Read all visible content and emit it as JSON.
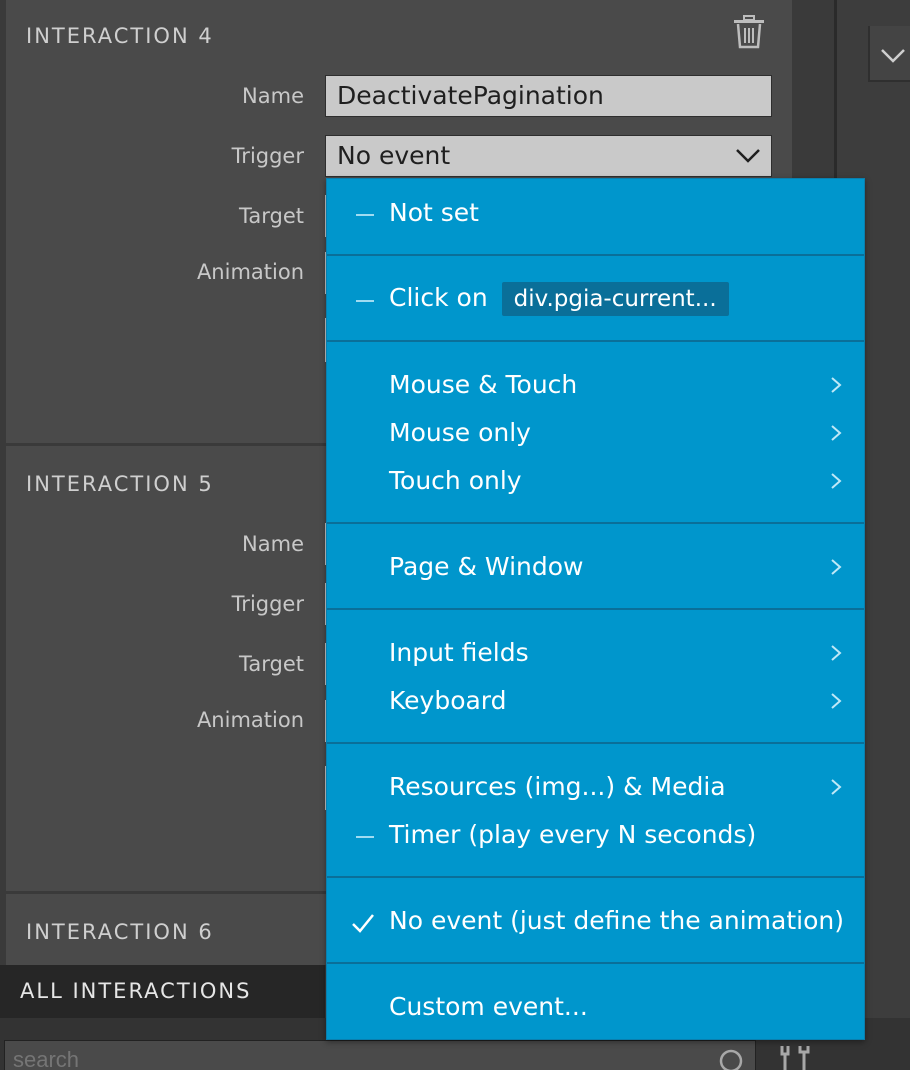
{
  "interactions": [
    {
      "title": "INTERACTION 4",
      "labels": {
        "name": "Name",
        "trigger": "Trigger",
        "target": "Target",
        "animation": "Animation"
      },
      "name_value": "DeactivatePagination",
      "trigger_value": "No event"
    },
    {
      "title": "INTERACTION 5",
      "labels": {
        "name": "Name",
        "trigger": "Trigger",
        "target": "Target",
        "animation": "Animation"
      }
    },
    {
      "title": "INTERACTION 6"
    }
  ],
  "footer": {
    "all_interactions": "ALL INTERACTIONS",
    "search_placeholder": "search"
  },
  "trigger_menu": {
    "not_set": "Not set",
    "click_on": "Click on",
    "click_on_target": "div.pgia-current...",
    "mouse_touch": "Mouse & Touch",
    "mouse_only": "Mouse only",
    "touch_only": "Touch only",
    "page_window": "Page & Window",
    "input_fields": "Input fields",
    "keyboard": "Keyboard",
    "resources_media": "Resources (img...) & Media",
    "timer": "Timer (play every N seconds)",
    "no_event": "No event (just define the animation)",
    "custom_event": "Custom event..."
  },
  "icons": {
    "trash": "trash-icon",
    "dropdown": "chevron-down-icon",
    "submenu": "chevron-right-icon",
    "checked": "check-icon",
    "search": "search-icon",
    "tools": "tools-icon"
  },
  "colors": {
    "panel": "#4a4a4a",
    "menu": "#0096cc",
    "menu_separator": "#0a6f99",
    "field": "#c9c9c9"
  }
}
